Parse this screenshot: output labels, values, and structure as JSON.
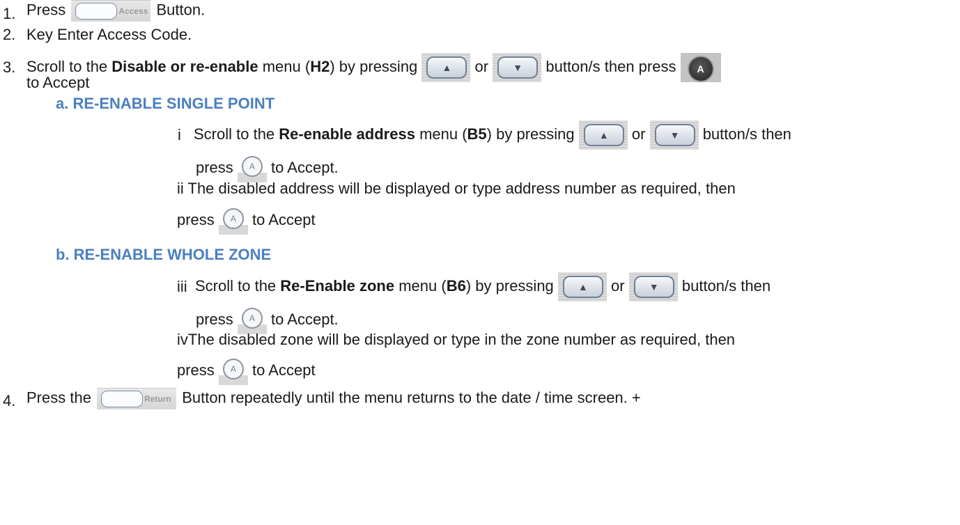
{
  "steps": {
    "s1": {
      "num": "1.",
      "pre": "Press",
      "post": "Button."
    },
    "s2": {
      "num": "2.",
      "text": "Key Enter Access Code."
    },
    "s3": {
      "num": "3.",
      "pre": "Scroll to the",
      "bold1": "Disable or re-enable",
      "mid1": "menu (",
      "bold2": "H2",
      "mid2": ") by pressing",
      "or": "or",
      "post": "button/s then press",
      "line2": "to Accept"
    },
    "s4": {
      "num": "4.",
      "pre": "Press the",
      "post": "Button repeatedly until the menu returns to the date / time screen.  +"
    }
  },
  "section_a": {
    "heading": "a.  RE-ENABLE SINGLE POINT",
    "i": {
      "num": "i",
      "pre": "Scroll to the",
      "bold1": "Re-enable address",
      "mid1": "menu (",
      "bold2": "B5",
      "mid2": ") by pressing",
      "or": "or",
      "post": "button/s then",
      "line2_pre": "press",
      "line2_post": "to Accept."
    },
    "ii": {
      "num": "ii",
      "text": "The disabled address will be displayed or type address number as required, then",
      "line2_pre": "press",
      "line2_post": "to Accept"
    }
  },
  "section_b": {
    "heading": "b.  RE-ENABLE WHOLE ZONE",
    "iii": {
      "num": "iii",
      "pre": "Scroll to the",
      "bold1": "Re-Enable zone",
      "mid1": "menu (",
      "bold2": "B6",
      "mid2": ") by pressing",
      "or": "or",
      "post": "button/s then",
      "line2_pre": "press",
      "line2_post": "to Accept."
    },
    "iv": {
      "num": "iv",
      "text": "The disabled zone will be displayed or type in the zone number as required, then",
      "line2_pre": "press",
      "line2_post": "to Accept"
    }
  },
  "buttons": {
    "access_label": "Access",
    "return_label": "Return",
    "up_glyph": "▲",
    "down_glyph": "▼",
    "accept_glyph": "A"
  },
  "colors": {
    "heading": "#4a7fc1",
    "text": "#1a1a1a"
  }
}
